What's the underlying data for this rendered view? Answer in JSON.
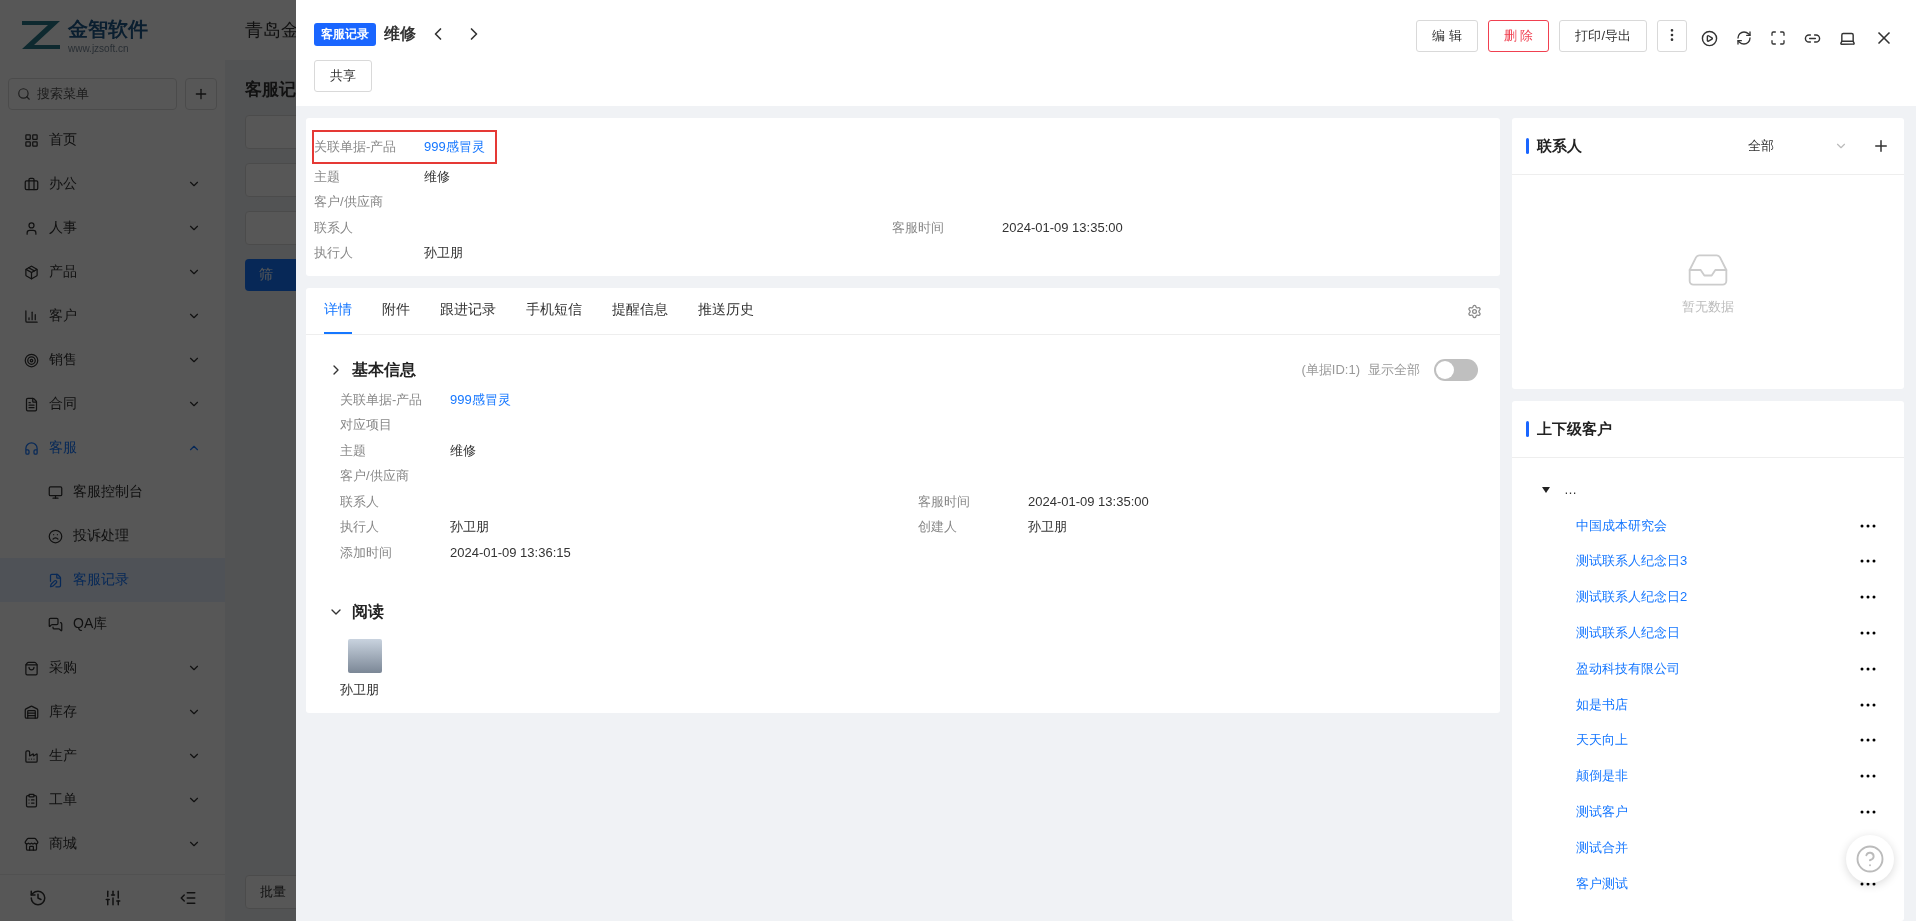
{
  "sidebar": {
    "logo_name": "金智软件",
    "logo_url": "www.jzsoft.cn",
    "search_placeholder": "搜索菜单",
    "items": [
      {
        "label": "首页",
        "kind": "link",
        "selected": false
      },
      {
        "label": "办公",
        "kind": "group",
        "expanded": false,
        "selected": false
      },
      {
        "label": "人事",
        "kind": "group",
        "expanded": false,
        "selected": false
      },
      {
        "label": "产品",
        "kind": "group",
        "expanded": false,
        "selected": false
      },
      {
        "label": "客户",
        "kind": "group",
        "expanded": false,
        "selected": false
      },
      {
        "label": "销售",
        "kind": "group",
        "expanded": false,
        "selected": false
      },
      {
        "label": "合同",
        "kind": "group",
        "expanded": false,
        "selected": false
      },
      {
        "label": "客服",
        "kind": "group",
        "expanded": true,
        "selected": true,
        "children": [
          {
            "label": "客服控制台",
            "selected": false
          },
          {
            "label": "投诉处理",
            "selected": false
          },
          {
            "label": "客服记录",
            "selected": true
          },
          {
            "label": "QA库",
            "selected": false
          }
        ]
      },
      {
        "label": "采购",
        "kind": "group",
        "expanded": false,
        "selected": false
      },
      {
        "label": "库存",
        "kind": "group",
        "expanded": false,
        "selected": false
      },
      {
        "label": "生产",
        "kind": "group",
        "expanded": false,
        "selected": false
      },
      {
        "label": "工单",
        "kind": "group",
        "expanded": false,
        "selected": false
      },
      {
        "label": "商城",
        "kind": "group",
        "expanded": false,
        "selected": false
      }
    ]
  },
  "background": {
    "company": "青岛金",
    "page_title": "客服记",
    "filter_button": "筛",
    "batch_button": "批量"
  },
  "drawer": {
    "badge": "客服记录",
    "title": "维修",
    "share_button": "共享",
    "actions": [
      {
        "label": "编 辑",
        "kind": "default"
      },
      {
        "label": "删 除",
        "kind": "danger"
      },
      {
        "label": "打印/导出",
        "kind": "default"
      }
    ],
    "info_rows": [
      {
        "highlighted": true,
        "cells": [
          {
            "label": "关联单据-产品",
            "value": "999感冒灵",
            "kind": "link"
          }
        ]
      },
      {
        "highlighted": false,
        "cells": [
          {
            "label": "主题",
            "value": "维修",
            "kind": "text"
          }
        ]
      },
      {
        "highlighted": false,
        "cells": [
          {
            "label": "客户/供应商",
            "kind": "text"
          }
        ]
      },
      {
        "highlighted": false,
        "cells": [
          {
            "label": "联系人",
            "kind": "text"
          },
          {
            "label": "客服时间",
            "value": "2024-01-09 13:35:00",
            "kind": "text"
          }
        ]
      },
      {
        "highlighted": false,
        "cells": [
          {
            "label": "执行人",
            "value": "孙卫朋",
            "kind": "text"
          }
        ]
      }
    ],
    "tabs": [
      {
        "label": "详情",
        "selected": true
      },
      {
        "label": "附件",
        "selected": false
      },
      {
        "label": "跟进记录",
        "selected": false
      },
      {
        "label": "手机短信",
        "selected": false
      },
      {
        "label": "提醒信息",
        "selected": false
      },
      {
        "label": "推送历史",
        "selected": false
      }
    ],
    "basic": {
      "title": "基本信息",
      "expanded": false,
      "record_id": "(单据ID:1)",
      "show_all_label": "显示全部",
      "show_all_on": false,
      "rows": [
        {
          "cells": [
            {
              "label": "关联单据-产品",
              "value": "999感冒灵",
              "kind": "link"
            }
          ]
        },
        {
          "cells": [
            {
              "label": "对应项目",
              "kind": "text"
            }
          ]
        },
        {
          "cells": [
            {
              "label": "主题",
              "value": "维修",
              "kind": "text"
            }
          ]
        },
        {
          "cells": [
            {
              "label": "客户/供应商",
              "kind": "text"
            }
          ]
        },
        {
          "cells": [
            {
              "label": "联系人",
              "kind": "text"
            },
            {
              "label": "客服时间",
              "value": "2024-01-09 13:35:00",
              "kind": "text"
            }
          ]
        },
        {
          "cells": [
            {
              "label": "执行人",
              "value": "孙卫朋",
              "kind": "text"
            },
            {
              "label": "创建人",
              "value": "孙卫朋",
              "kind": "text"
            }
          ]
        },
        {
          "cells": [
            {
              "label": "添加时间",
              "value": "2024-01-09 13:36:15",
              "kind": "text"
            }
          ]
        }
      ]
    },
    "read": {
      "title": "阅读",
      "expanded": true,
      "readers": [
        "孙卫朋"
      ]
    },
    "contacts": {
      "title": "联系人",
      "filter": "全部",
      "empty_text": "暂无数据"
    },
    "hierarchy": {
      "title": "上下级客户",
      "root": {
        "label": "…",
        "expanded": true,
        "children": [
          "中国成本研究会",
          "测试联系人纪念日3",
          "测试联系人纪念日2",
          "测试联系人纪念日",
          "盈动科技有限公司",
          "如是书店",
          "天天向上",
          "颠倒是非",
          "测试客户",
          "测试合并",
          "客户测试"
        ]
      }
    }
  }
}
